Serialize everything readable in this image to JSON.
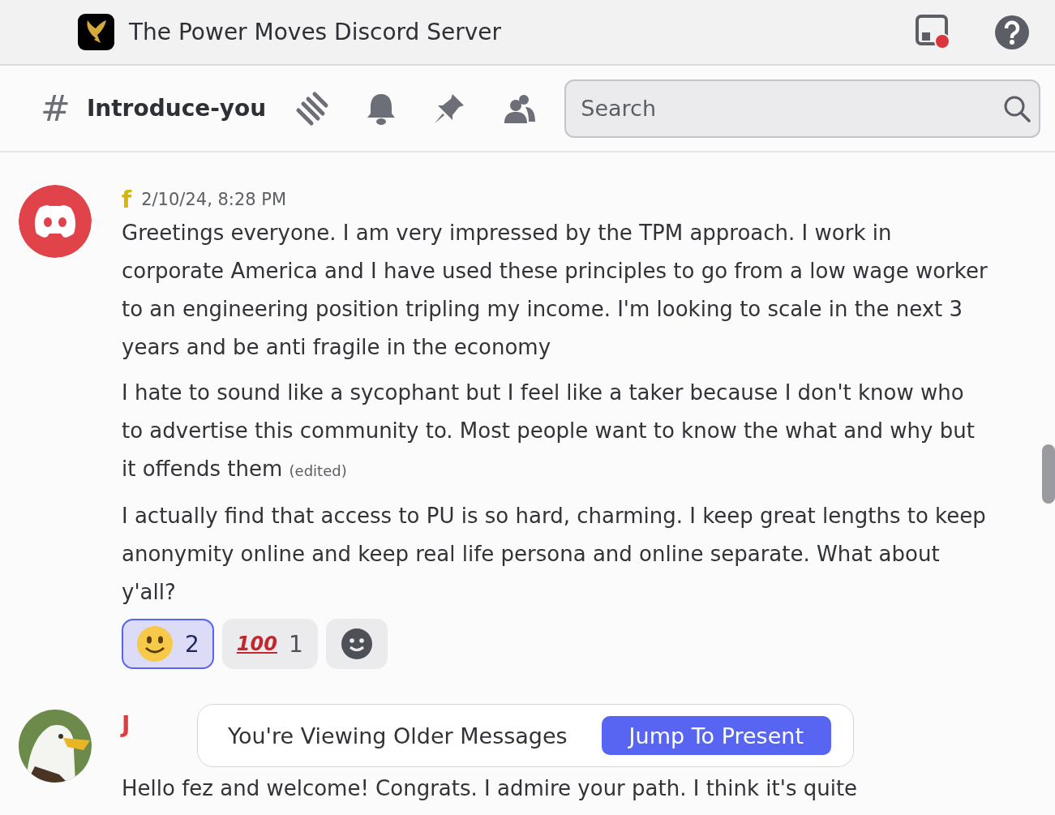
{
  "window": {
    "title": "The Power Moves Discord Server"
  },
  "channel": {
    "hash": "#",
    "name": "Introduce-you"
  },
  "search": {
    "placeholder": "Search"
  },
  "messages": [
    {
      "author": "f",
      "color": "#d4b50c",
      "timestamp": "2/10/24, 8:28 PM",
      "avatar": {
        "kind": "logo"
      },
      "paragraphs": [
        {
          "text": "Greetings everyone. I am very impressed by the TPM approach. I work in corporate America and I have used these principles to go from a low wage worker to an engineering position tripling my income. I'm looking to scale in the next 3 years and be anti fragile in the economy"
        },
        {
          "text": "I hate to sound like a sycophant but I feel like a taker because I don't know who to advertise this community to. Most people want to know the what and why but it offends them",
          "edited": "(edited)"
        },
        {
          "text": "I actually find that access to PU is so hard, charming. I keep great lengths to keep anonymity online and keep real life persona and online separate. What about y'all?"
        }
      ],
      "reactions": [
        {
          "kind": "smile",
          "count": "2",
          "selected": true
        },
        {
          "kind": "hundred",
          "emoji": "100",
          "count": "1",
          "selected": false
        }
      ]
    },
    {
      "author": "J",
      "color": "#e03e3e",
      "avatar": {
        "kind": "picture"
      },
      "paragraphs": [
        {
          "text": "Hello fez and welcome! Congrats. I admire your path. I think it's quite"
        }
      ]
    }
  ],
  "banner": {
    "text": "You're Viewing Older Messages",
    "button": "Jump To Present"
  }
}
